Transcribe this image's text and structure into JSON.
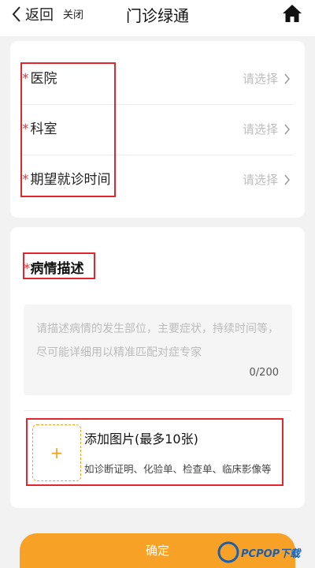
{
  "nav": {
    "back_label": "返回",
    "close_label": "关闭",
    "title": "门诊绿通"
  },
  "form": {
    "required_mark": "*",
    "fields": [
      {
        "label": "医院",
        "value": "请选择"
      },
      {
        "label": "科室",
        "value": "请选择"
      },
      {
        "label": "期望就诊时间",
        "value": "请选择"
      }
    ]
  },
  "description": {
    "title": "病情描述",
    "placeholder": "请描述病情的发生部位，主要症状，持续时间等，尽可能详细用以精准匹配对症专家",
    "counter": "0/200"
  },
  "upload": {
    "plus": "+",
    "title": "添加图片(最多10张)",
    "subtitle": "如诊断证明、化验单、检查单、临床影像等"
  },
  "footer": {
    "confirm_label": "确定"
  },
  "watermark": {
    "text": "PCPOP下载"
  },
  "colors": {
    "accent": "#f7a227",
    "required": "#e4393c",
    "annotation": "#e3262e"
  }
}
